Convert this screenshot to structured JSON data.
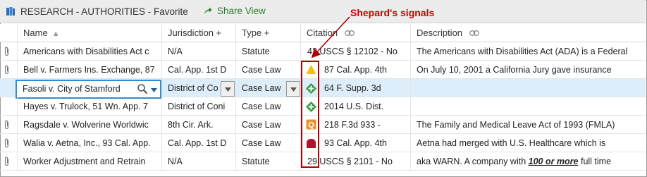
{
  "window": {
    "title": "RESEARCH - AUTHORITIES - Favorite",
    "share_label": "Share View"
  },
  "annotation": {
    "label": "Shepard's signals"
  },
  "columns": [
    {
      "label": "Name",
      "indicator": "▲"
    },
    {
      "label": "Jurisdiction +",
      "indicator": ""
    },
    {
      "label": "Type +",
      "indicator": ""
    },
    {
      "label": "Citation",
      "indicator": "link-icon"
    },
    {
      "label": "Description",
      "indicator": "link-icon"
    }
  ],
  "rows": [
    {
      "attachment": true,
      "name": "Americans with Disabilities Act c",
      "jurisdiction": "N/A",
      "type": "Statute",
      "signal": "",
      "citation": "42 USCS § 12102 - No",
      "description": "The Americans with Disabilities Act (ADA) is a Federal"
    },
    {
      "attachment": true,
      "name": "Bell v. Farmers Ins. Exchange, 87",
      "jurisdiction": "Cal. App. 1st D",
      "type": "Case Law",
      "signal": "caution-triangle",
      "citation": "87 Cal. App. 4th",
      "description": "On July 10, 2001 a California Jury gave insurance"
    },
    {
      "attachment": false,
      "name": "Fasoli v. City of Stamford",
      "jurisdiction": "District of Co",
      "type": "Case Law",
      "signal": "positive-diamond",
      "citation": "64 F. Supp. 3d",
      "description": "",
      "selected": true
    },
    {
      "attachment": false,
      "name": "Hayes v. Trulock, 51 Wn. App. 7",
      "jurisdiction": "District of Coni",
      "type": "Case Law",
      "signal": "positive-diamond",
      "citation": "2014 U.S. Dist.",
      "description": ""
    },
    {
      "attachment": true,
      "name": "Ragsdale v. Wolverine Worldwic",
      "jurisdiction": "8th Cir. Ark.",
      "type": "Case Law",
      "signal": "questioned-q",
      "citation": "218 F.3d 933 -",
      "description": "The Family and Medical Leave Act of 1993 (FMLA)"
    },
    {
      "attachment": true,
      "name": "Walia v. Aetna, Inc., 93 Cal. App.",
      "jurisdiction": "Cal. App. 1st D",
      "type": "Case Law",
      "signal": "warning-stop",
      "citation": "93 Cal. App. 4th",
      "description": "Aetna had merged with U.S. Healthcare which is"
    },
    {
      "attachment": true,
      "name": "Worker Adjustment and Retrain",
      "jurisdiction": "N/A",
      "type": "Statute",
      "signal": "",
      "citation": "29 USCS § 2101 - No",
      "description": "aka WARN. A company with ",
      "description_emphasis": "100 or more",
      "description_tail": " full time"
    }
  ],
  "colors": {
    "share_green": "#2d7d2d",
    "annotation_red": "#cc0000",
    "selection_blue": "#ddeefa",
    "caution_yellow": "#f2c200",
    "positive_green": "#2f9a3a",
    "questioned_orange": "#e8922a",
    "warning_red": "#b3112b"
  }
}
